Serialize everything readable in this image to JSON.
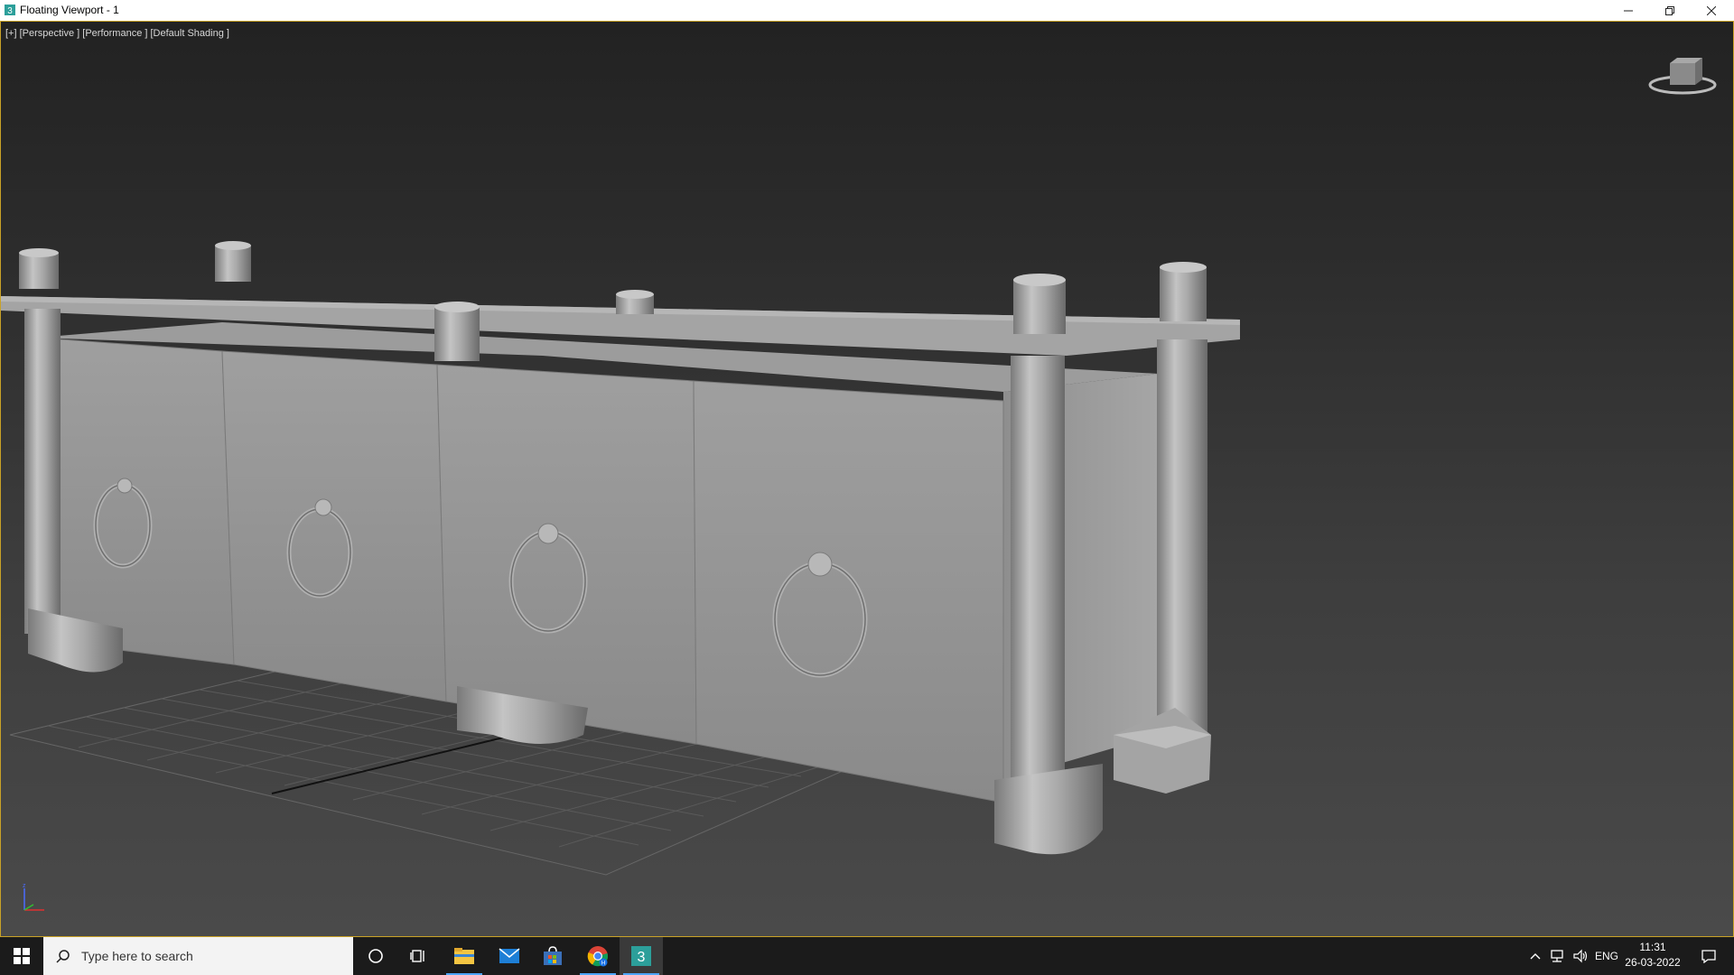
{
  "window": {
    "title": "Floating Viewport - 1"
  },
  "viewport": {
    "label": "[+] [Perspective ] [Performance ] [Default Shading ]"
  },
  "taskbar": {
    "search_placeholder": "Type here to search",
    "apps": [
      {
        "name": "cortana-icon"
      },
      {
        "name": "task-view-icon"
      },
      {
        "name": "file-explorer-icon"
      },
      {
        "name": "mail-icon"
      },
      {
        "name": "store-icon"
      },
      {
        "name": "chrome-icon"
      },
      {
        "name": "3ds-max-icon",
        "badge": "3"
      }
    ],
    "tray": {
      "language": "ENG",
      "time": "11:31",
      "date": "26-03-2022"
    }
  },
  "colors": {
    "viewport_border": "#c9a227",
    "taskbar": "#1b1b1b",
    "accent": "#4ca6ff",
    "model": "#9a9a9a"
  }
}
